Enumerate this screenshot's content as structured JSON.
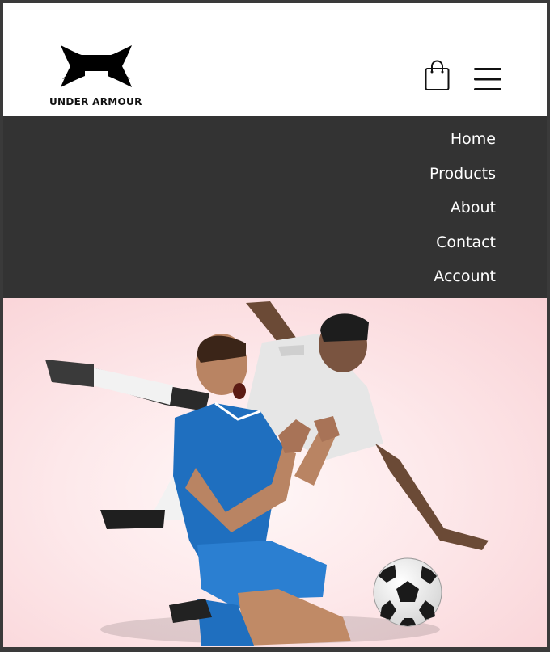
{
  "brand": {
    "name": "UNDER ARMOUR",
    "logo_icon": "under-armour-logo"
  },
  "header": {
    "cart_icon": "shopping-bag-icon",
    "menu_icon": "hamburger-menu-icon"
  },
  "nav": {
    "items": [
      {
        "label": "Home"
      },
      {
        "label": "Products"
      },
      {
        "label": "About"
      },
      {
        "label": "Contact"
      },
      {
        "label": "Account"
      }
    ]
  },
  "hero": {
    "image": "soccer-players-celebration-photo"
  },
  "colors": {
    "nav_background": "#333333",
    "header_background": "#ffffff",
    "hero_background": "#fde8ea",
    "frame_border": "#3a3a3a"
  }
}
